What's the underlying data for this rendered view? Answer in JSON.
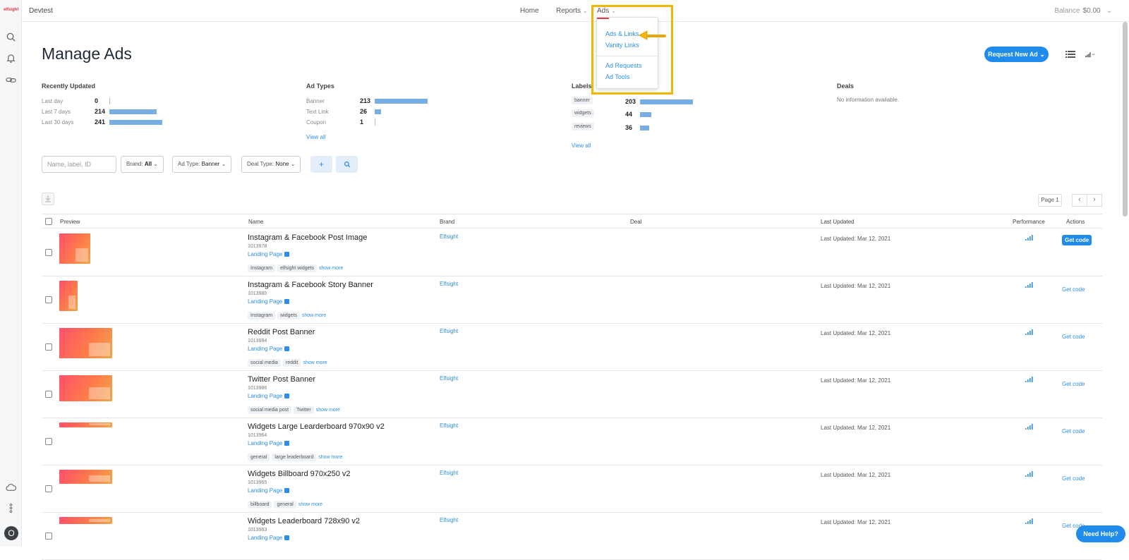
{
  "sidebar": {
    "logo": "elfsight",
    "avatar_initial": "O"
  },
  "topbar": {
    "workspace": "Devtest",
    "nav": {
      "home": "Home",
      "reports": "Reports",
      "ads": "Ads"
    },
    "balance_label": "Balance",
    "balance_value": "$0.00"
  },
  "ads_menu": {
    "items": [
      "Ads & Links",
      "Vanity Links",
      "Ad Requests",
      "Ad Tools"
    ]
  },
  "page": {
    "title": "Manage Ads",
    "request_button": "Request New Ad"
  },
  "stats": {
    "recently_updated": {
      "title": "Recently Updated",
      "rows": [
        {
          "label": "Last day",
          "value": "0",
          "frac": 0
        },
        {
          "label": "Last 7 days",
          "value": "214",
          "frac": 0.888
        },
        {
          "label": "Last 30 days",
          "value": "241",
          "frac": 1.0
        }
      ]
    },
    "ad_types": {
      "title": "Ad Types",
      "rows": [
        {
          "label": "Banner",
          "value": "213",
          "frac": 1.0
        },
        {
          "label": "Text Link",
          "value": "26",
          "frac": 0.122
        },
        {
          "label": "Coupon",
          "value": "1",
          "frac": 0
        }
      ],
      "view_all": "View all"
    },
    "labels": {
      "title": "Labels",
      "rows": [
        {
          "label": "banner",
          "value": "203",
          "frac": 1.0
        },
        {
          "label": "widgets",
          "value": "44",
          "frac": 0.217
        },
        {
          "label": "reviews",
          "value": "36",
          "frac": 0.177
        }
      ],
      "view_all": "View all"
    },
    "deals": {
      "title": "Deals",
      "empty": "No information available."
    }
  },
  "filters": {
    "search_placeholder": "Name, label, ID",
    "brand_label": "Brand:",
    "brand_value": "All",
    "ad_type_label": "Ad Type:",
    "ad_type_value": "Banner",
    "deal_type_label": "Deal Type:",
    "deal_type_value": "None"
  },
  "pagination": {
    "page_label": "Page 1"
  },
  "table": {
    "headers": {
      "preview": "Preview",
      "name": "Name",
      "brand": "Brand",
      "deal": "Deal",
      "last_updated": "Last Updated",
      "performance": "Performance",
      "actions": "Actions"
    },
    "rows": [
      {
        "name": "Instagram & Facebook Post Image",
        "id": "1013978",
        "link": "Landing Page",
        "tags": [
          "Instagram",
          "elfsight widgets"
        ],
        "more": "show more",
        "brand": "Elfsight",
        "updated": "Last Updated: Mar 12, 2021",
        "action": "Get code"
      },
      {
        "name": "Instagram & Facebook Story Banner",
        "id": "1013980",
        "link": "Landing Page",
        "tags": [
          "Instagram",
          "widgets"
        ],
        "more": "show more",
        "brand": "Elfsight",
        "updated": "Last Updated: Mar 12, 2021",
        "action": "Get code"
      },
      {
        "name": "Reddit Post Banner",
        "id": "1013984",
        "link": "Landing Page",
        "tags": [
          "social media",
          "reddit"
        ],
        "more": "show more",
        "brand": "Elfsight",
        "updated": "Last Updated: Mar 12, 2021",
        "action": "Get code"
      },
      {
        "name": "Twitter Post Banner",
        "id": "1013986",
        "link": "Landing Page",
        "tags": [
          "social media post",
          "Twitter"
        ],
        "more": "show more",
        "brand": "Elfsight",
        "updated": "Last Updated: Mar 12, 2021",
        "action": "Get code"
      },
      {
        "name": "Widgets Large Learderboard 970x90 v2",
        "id": "1013964",
        "link": "Landing Page",
        "tags": [
          "general",
          "large leaderboard"
        ],
        "more": "show more",
        "brand": "Elfsight",
        "updated": "Last Updated: Mar 12, 2021",
        "action": "Get code"
      },
      {
        "name": "Widgets Billboard 970x250 v2",
        "id": "1013965",
        "link": "Landing Page",
        "tags": [
          "billboard",
          "general"
        ],
        "more": "show more",
        "brand": "Elfsight",
        "updated": "Last Updated: Mar 12, 2021",
        "action": "Get code"
      },
      {
        "name": "Widgets Leaderboard 728x90 v2",
        "id": "1013963",
        "link": "Landing Page",
        "tags": [],
        "more": "",
        "brand": "Elfsight",
        "updated": "Last Updated: Mar 12, 2021",
        "action": "Get code"
      }
    ]
  },
  "help_button": "Need Help?",
  "colors": {
    "accent": "#1f8ceb",
    "link": "#2b8ee6",
    "bar": "#78aee3",
    "highlight": "#f2b705",
    "brand_red": "#e5384e"
  },
  "icons": [
    "search-icon",
    "bell-icon",
    "link-icon",
    "cloud-icon",
    "more-vertical-icon",
    "list-view-icon",
    "signal-icon",
    "plus-icon",
    "download-icon",
    "chevron-left-icon",
    "chevron-right-icon",
    "external-link-icon",
    "pointer-arrow-icon"
  ]
}
